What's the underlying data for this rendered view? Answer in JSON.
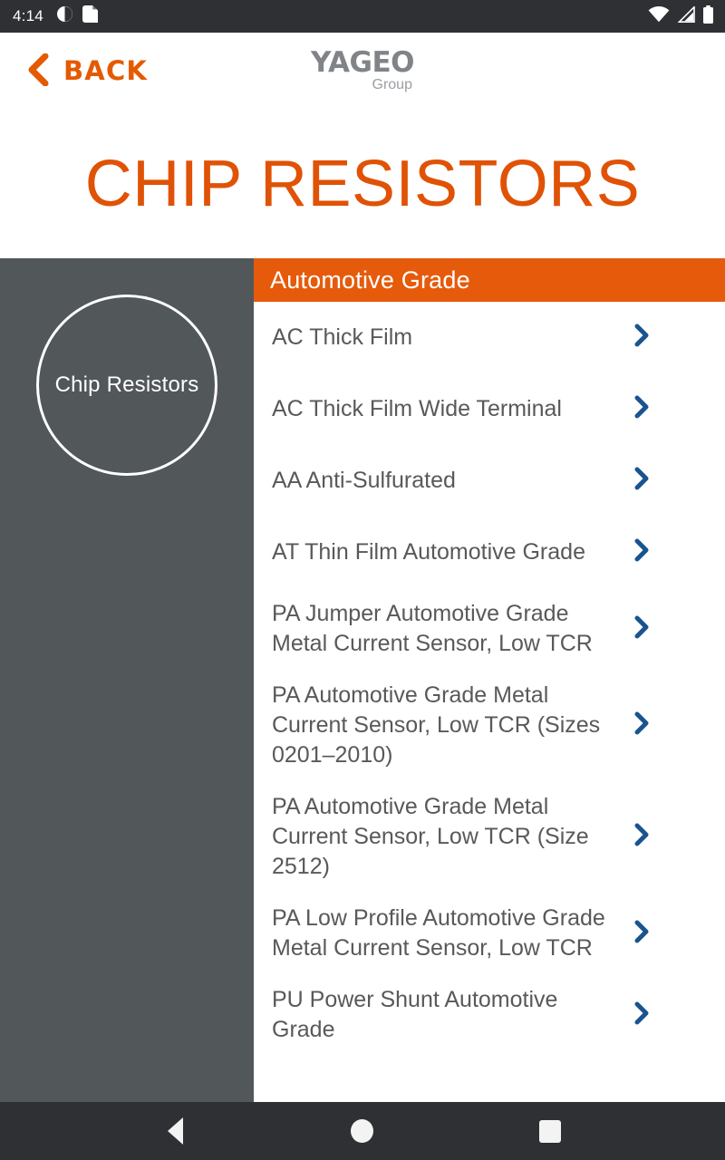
{
  "status_bar": {
    "time": "4:14",
    "left_icons": [
      "app-notification-icon",
      "sd-card-icon"
    ],
    "right_icons": [
      "wifi-icon",
      "cellular-signal-icon",
      "battery-icon"
    ]
  },
  "app_bar": {
    "back_label": "BACK",
    "back_icon": "chevron-left-icon",
    "logo_main": "YAGEO",
    "logo_sub": "Group"
  },
  "hero": {
    "title": "CHIP RESISTORS"
  },
  "sidebar": {
    "circle_label": "Chip Resistors"
  },
  "list_section": {
    "header": "Automotive Grade",
    "items": [
      {
        "label": "AC Thick Film",
        "chevron": "chevron-right-icon"
      },
      {
        "label": "AC Thick Film Wide Terminal",
        "chevron": "chevron-right-icon"
      },
      {
        "label": "AA Anti-Sulfurated",
        "chevron": "chevron-right-icon"
      },
      {
        "label": "AT Thin Film Automotive Grade",
        "chevron": "chevron-right-icon"
      },
      {
        "label": "PA Jumper Automotive Grade Metal Current Sensor, Low TCR",
        "chevron": "chevron-right-icon"
      },
      {
        "label": "PA Automotive Grade Metal Current Sensor, Low TCR (Sizes 0201–2010)",
        "chevron": "chevron-right-icon"
      },
      {
        "label": "PA Automotive Grade Metal Current Sensor, Low TCR (Size 2512)",
        "chevron": "chevron-right-icon"
      },
      {
        "label": "PA Low Profile Automotive Grade Metal Current Sensor, Low TCR",
        "chevron": "chevron-right-icon"
      },
      {
        "label": "PU Power Shunt Automotive Grade",
        "chevron": "chevron-right-icon"
      }
    ]
  },
  "nav_bar": {
    "back": "nav-back-icon",
    "home": "nav-home-icon",
    "recents": "nav-recents-icon"
  },
  "colors": {
    "accent_orange": "#e05206",
    "header_orange": "#e55b0b",
    "sidebar_gray": "#52575a",
    "chevron_blue": "#1a5490",
    "text_gray": "#58595b",
    "system_bar": "#2e3033"
  }
}
